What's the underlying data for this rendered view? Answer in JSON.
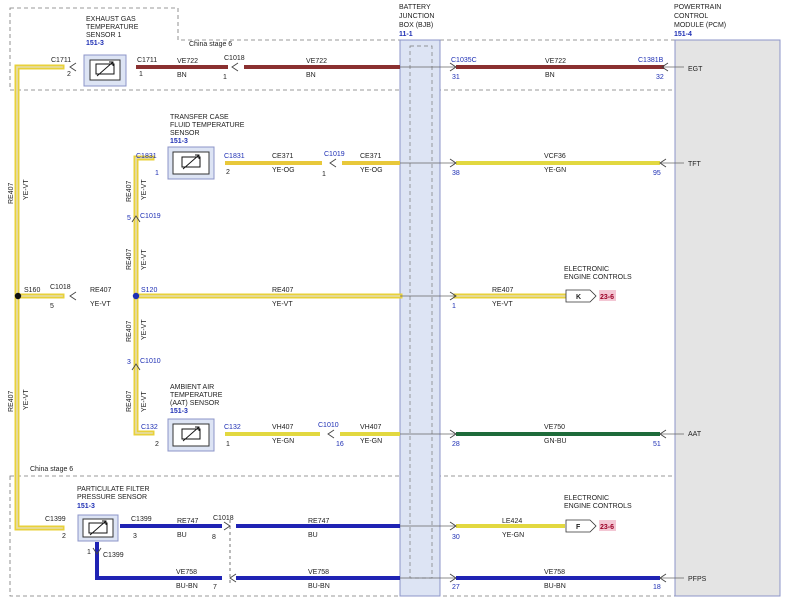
{
  "colors": {
    "ye_vt": "#e8d13a",
    "ye_vt_core": "#e6ddb0",
    "ye_og": "#e8c83a",
    "ye_gn": "#e2d840",
    "bn": "#8a3030",
    "bu": "#1f23b4",
    "bu_bn": "#1f23b4",
    "gn_bu": "#1e6b3a",
    "box_fill": "#dde4f4",
    "box_stroke": "#8c95c8",
    "connector_blue": "#1e2fb4",
    "ref_fill": "#f3c7d4",
    "ref_text": "#9c0026"
  },
  "modules": {
    "bjb": {
      "lines": [
        "BATTERY",
        "JUNCTION",
        "BOX (BJB)"
      ],
      "ref": "11-1"
    },
    "pcm": {
      "lines": [
        "POWERTRAIN",
        "CONTROL",
        "MODULE (PCM)"
      ],
      "ref": "151-4"
    }
  },
  "regions": {
    "top": "China stage 6",
    "bottom": "China stage 6"
  },
  "components": {
    "egt_sensor": {
      "lines": [
        "EXHAUST GAS",
        "TEMPERATURE",
        "SENSOR 1"
      ],
      "ref": "151-3"
    },
    "tft_sensor": {
      "lines": [
        "TRANSFER CASE",
        "FLUID TEMPERATURE",
        "SENSOR"
      ],
      "ref": "151-3"
    },
    "aat_sensor": {
      "lines": [
        "AMBIENT AIR",
        "TEMPERATURE",
        "(AAT) SENSOR"
      ],
      "ref": "151-3"
    },
    "pfp_sensor": {
      "lines": [
        "PARTICULATE FILTER",
        "PRESSURE SENSOR"
      ],
      "ref": "151-3"
    },
    "eec_k": {
      "lines": [
        "ELECTRONIC",
        "ENGINE CONTROLS"
      ],
      "letter": "K",
      "ref": "23-6"
    },
    "eec_f": {
      "lines": [
        "ELECTRONIC",
        "ENGINE CONTROLS"
      ],
      "letter": "F",
      "ref": "23-6"
    }
  },
  "splices": {
    "s160": "S160",
    "s120": "S120"
  },
  "pcm_pins": {
    "egt": "EGT",
    "tft": "TFT",
    "aat": "AAT",
    "pfps": "PFPS"
  },
  "circuits": {
    "egt_row": {
      "sensor_left_conn": "C1711",
      "sensor_left_pin": "2",
      "sensor_right_conn": "C1711",
      "sensor_right_pin": "1",
      "wire1": "VE722",
      "color1": "BN",
      "inline_conn": "C1018",
      "inline_pin": "1",
      "wire2": "VE722",
      "color2": "BN",
      "bjb_conn": "C1035C",
      "bjb_pin": "31",
      "wire3": "VE722",
      "color3": "BN",
      "pcm_conn": "C1381B",
      "pcm_pin": "32"
    },
    "tft_row": {
      "upper_conn": "C1831",
      "upper_pin": "1",
      "sensor_conn": "C1831",
      "sensor_pin": "2",
      "wire1": "CE371",
      "color1": "YE-OG",
      "inline_conn": "C1019",
      "inline_pin": "1",
      "wire2": "CE371",
      "color2": "YE-OG",
      "bjb_pin": "38",
      "wire3": "VCF36",
      "color3": "YE-GN",
      "pcm_pin": "95"
    },
    "vertical_tft": {
      "wire": "RE407",
      "color": "YE-VT",
      "conn": "C1019",
      "pin": "5"
    },
    "vertical_mid_up": {
      "wire": "RE407",
      "color": "YE-VT"
    },
    "vertical_mid_down": {
      "wire": "RE407",
      "color": "YE-VT",
      "conn": "C1010",
      "pin": "3"
    },
    "vertical_aat": {
      "wire": "RE407",
      "color": "YE-VT"
    },
    "s120_row": {
      "left_conn": "C1018",
      "left_pin": "5",
      "left_wire": "RE407",
      "left_color": "YE-VT",
      "mid_wire": "RE407",
      "mid_color": "YE-VT",
      "bjb_pin": "1",
      "right_wire": "RE407",
      "right_color": "YE-VT"
    },
    "aat_row": {
      "left_conn": "C132",
      "left_pin": "2",
      "sensor_conn": "C132",
      "sensor_pin": "1",
      "wire1": "VH407",
      "color1": "YE-GN",
      "inline_conn": "C1010",
      "inline_pin": "16",
      "wire2": "VH407",
      "color2": "YE-GN",
      "bjb_pin": "28",
      "wire3": "VE750",
      "color3": "GN-BU",
      "pcm_pin": "51"
    },
    "left_trunk_upper": {
      "wire": "RE407",
      "color": "YE-VT"
    },
    "left_trunk_lower": {
      "wire": "RE407",
      "color": "YE-VT"
    },
    "pfp_row": {
      "left_conn": "C1399",
      "left_pin": "2",
      "right_conn": "C1399",
      "right_pin": "3",
      "wire1": "RE747",
      "color1": "BU",
      "inline_conn": "C1018",
      "inline_pin": "8",
      "wire2": "RE747",
      "color2": "BU",
      "bjb_pin": "30",
      "wire3": "LE424",
      "color3": "YE-GN"
    },
    "pfps_row": {
      "lower_conn": "C1399",
      "lower_pin": "1",
      "wire1": "VE758",
      "color1": "BU-BN",
      "inline_pin": "7",
      "wire2": "VE758",
      "color2": "BU-BN",
      "bjb_pin": "27",
      "wire3": "VE758",
      "color3": "BU-BN",
      "pcm_pin": "18"
    }
  }
}
